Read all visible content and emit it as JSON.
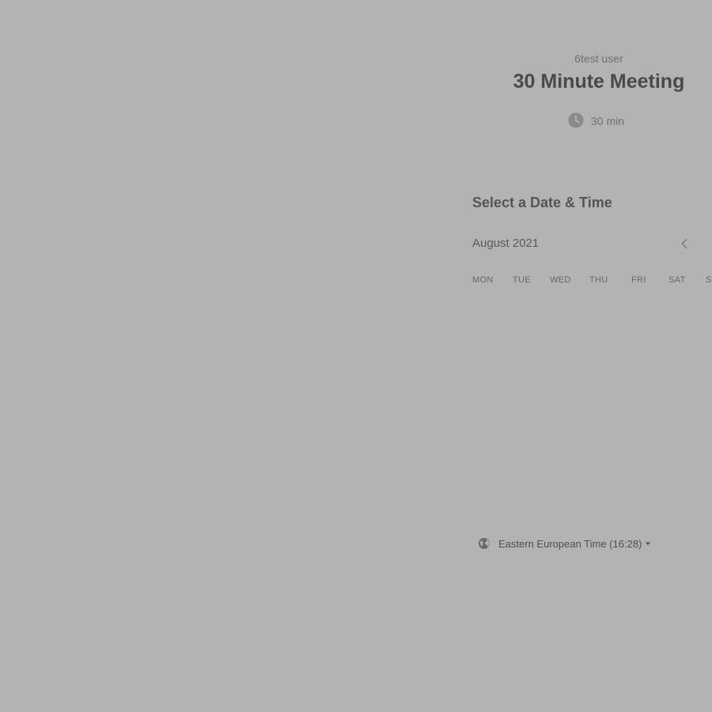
{
  "event": {
    "host": "6test user",
    "title": "30 Minute Meeting",
    "duration_label": "30 min",
    "duration_icon": "clock-icon"
  },
  "scheduler": {
    "heading": "Select a Date & Time",
    "month": "August 2021",
    "prev_icon": "chevron-left-icon",
    "weekdays": [
      "MON",
      "TUE",
      "WED",
      "THU",
      "FRI",
      "SAT",
      "S"
    ]
  },
  "timezone": {
    "icon": "globe-icon",
    "label": "Eastern European Time (16:28)",
    "caret_icon": "caret-down-icon"
  },
  "colors": {
    "overlay": "#b3b3b3",
    "title": "#4a4a4a",
    "muted": "#6f6f6f"
  }
}
